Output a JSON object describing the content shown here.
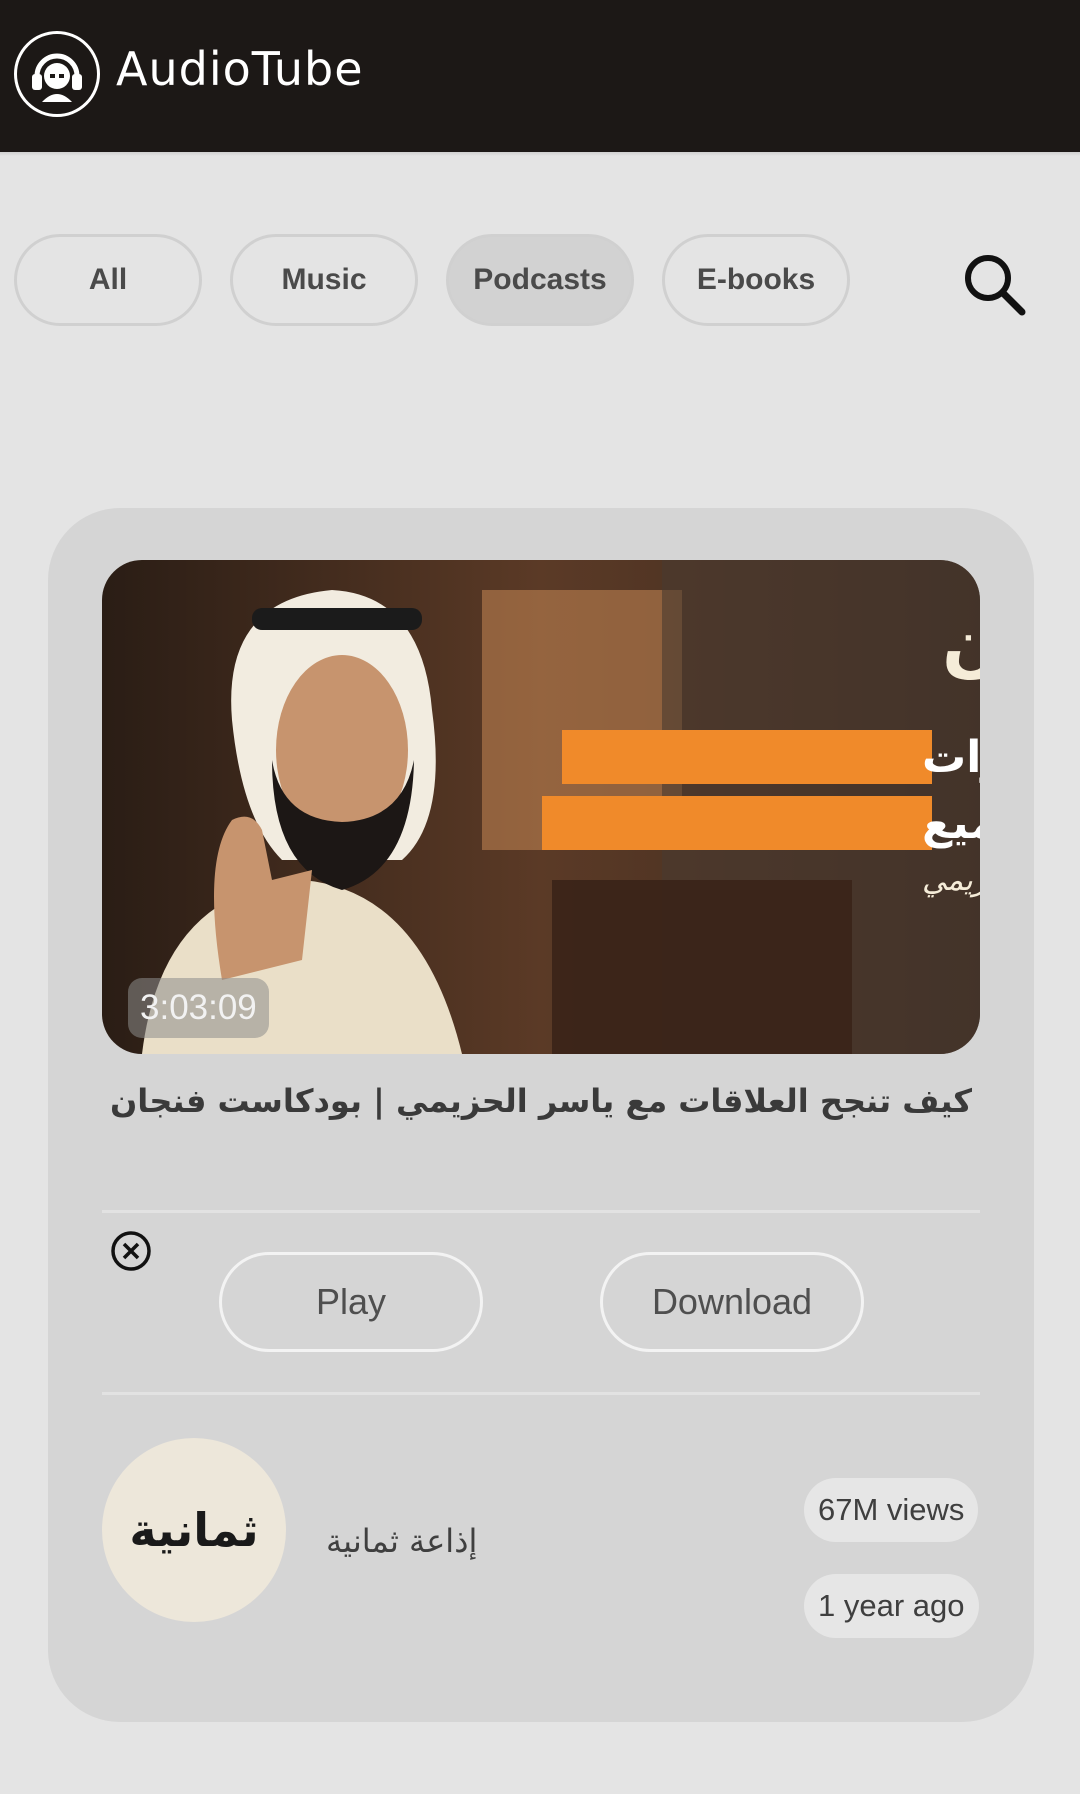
{
  "app": {
    "title": "AudioTube",
    "logo_icon": "headphones-user-icon"
  },
  "filters": {
    "chips": [
      {
        "label": "All",
        "active": false
      },
      {
        "label": "Music",
        "active": false
      },
      {
        "label": "Podcasts",
        "active": true
      },
      {
        "label": "E-books",
        "active": false
      }
    ],
    "search_icon": "search-icon"
  },
  "video": {
    "thumbnail_text": {
      "brand": "فنجان",
      "line1": "رحب بالعداوات",
      "line2": "ولا تكسب الجميع",
      "signature": "ياسر الحزيمي"
    },
    "duration": "3:03:09",
    "title": "كيف تنجح العلاقات مع ياسر الحزيمي | بودكاست فنجان",
    "actions": {
      "play": "Play",
      "download": "Download",
      "dismiss_icon": "close-circle-icon"
    },
    "channel": {
      "name": "إذاعة ثمانية",
      "avatar_text": "ثمانية"
    },
    "views": "67M views",
    "published": "1 year ago"
  },
  "colors": {
    "appbar": "#1c1816",
    "background": "#e4e4e4",
    "card": "#d5d5d5",
    "thumbnail_highlight": "#f08a2a"
  }
}
